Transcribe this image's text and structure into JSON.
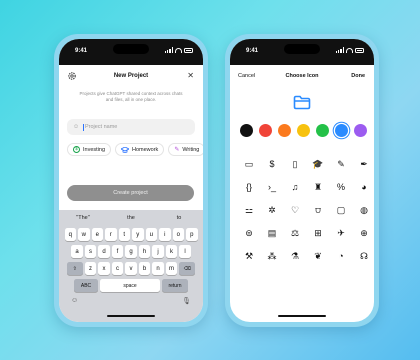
{
  "status_time": "9:41",
  "new_project": {
    "title": "New Project",
    "description": "Projects give ChatGPT shared context across chats and files, all in one place.",
    "input_placeholder": "Project name",
    "chips": [
      {
        "icon": "dollar-icon",
        "glyph": "$",
        "color": "#17a34a",
        "label": "Investing"
      },
      {
        "icon": "graduation-cap-icon",
        "glyph": "🎓",
        "color": "#2a72ff",
        "label": "Homework"
      },
      {
        "icon": "pencil-icon",
        "glyph": "✎",
        "color": "#b04ad8",
        "label": "Writing"
      }
    ],
    "create_button": "Create project"
  },
  "keyboard": {
    "suggestions": [
      "\"The\"",
      "the",
      "to"
    ],
    "row1": [
      "q",
      "w",
      "e",
      "r",
      "t",
      "y",
      "u",
      "i",
      "o",
      "p"
    ],
    "row2": [
      "a",
      "s",
      "d",
      "f",
      "g",
      "h",
      "j",
      "k",
      "l"
    ],
    "row3": [
      "z",
      "x",
      "c",
      "v",
      "b",
      "n",
      "m"
    ],
    "abc_label": "ABC",
    "space_label": "space",
    "return_label": "return"
  },
  "choose_icon": {
    "cancel": "Cancel",
    "title": "Choose Icon",
    "done": "Done",
    "preview_color": "#2a8bff",
    "swatches": [
      "#111111",
      "#f04438",
      "#fb7a1e",
      "#f7c20f",
      "#24c148",
      "#2a8bff",
      "#9c5cf0"
    ],
    "selected_swatch": 5,
    "icons": [
      {
        "name": "folder-icon",
        "glyph": "▭"
      },
      {
        "name": "dollar-icon",
        "glyph": "$"
      },
      {
        "name": "book-icon",
        "glyph": "▯"
      },
      {
        "name": "graduation-cap-icon",
        "glyph": "🎓"
      },
      {
        "name": "pencil-icon",
        "glyph": "✎"
      },
      {
        "name": "pen-icon",
        "glyph": "✒"
      },
      {
        "name": "braces-icon",
        "glyph": "{}"
      },
      {
        "name": "terminal-icon",
        "glyph": "›_"
      },
      {
        "name": "music-note-icon",
        "glyph": "♫"
      },
      {
        "name": "popcorn-icon",
        "glyph": "♜"
      },
      {
        "name": "percent-icon",
        "glyph": "%"
      },
      {
        "name": "palette-icon",
        "glyph": "◕"
      },
      {
        "name": "dumbbell-icon",
        "glyph": "⚍"
      },
      {
        "name": "settings-icon",
        "glyph": "✲"
      },
      {
        "name": "heart-icon",
        "glyph": "♡"
      },
      {
        "name": "basket-icon",
        "glyph": "⩌"
      },
      {
        "name": "tablet-icon",
        "glyph": "▢"
      },
      {
        "name": "apple-icon",
        "glyph": "◍"
      },
      {
        "name": "baseball-icon",
        "glyph": "⊜"
      },
      {
        "name": "document-icon",
        "glyph": "▤"
      },
      {
        "name": "scales-icon",
        "glyph": "⚖"
      },
      {
        "name": "gift-icon",
        "glyph": "⊞"
      },
      {
        "name": "airplane-icon",
        "glyph": "✈"
      },
      {
        "name": "globe-icon",
        "glyph": "⊕"
      },
      {
        "name": "wrench-icon",
        "glyph": "⚒"
      },
      {
        "name": "paw-icon",
        "glyph": "⁂"
      },
      {
        "name": "flask-icon",
        "glyph": "⚗"
      },
      {
        "name": "brain-icon",
        "glyph": "❦"
      },
      {
        "name": "chart-icon",
        "glyph": "◔"
      },
      {
        "name": "stethoscope-icon",
        "glyph": "☊"
      }
    ]
  }
}
